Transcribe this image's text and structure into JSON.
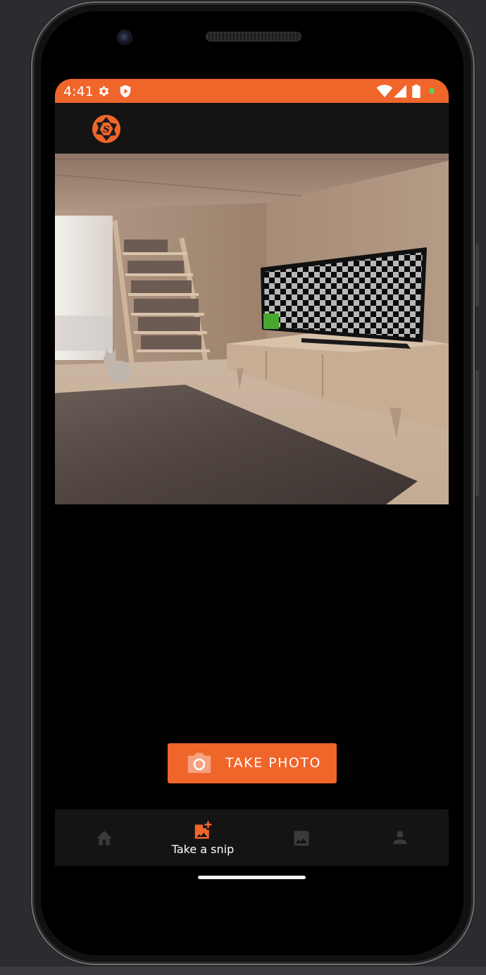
{
  "status_bar": {
    "time": "4:41",
    "background_color": "#f0652a",
    "icons": [
      "settings-gear-icon",
      "shield-icon",
      "wifi-icon",
      "signal-icon",
      "battery-icon",
      "notification-dot-icon"
    ]
  },
  "app_bar": {
    "logo": "aperture-s-logo",
    "logo_letter": "S"
  },
  "preview": {
    "content": "room-interior-photo"
  },
  "actions": {
    "take_photo_label": "TAKE PHOTO",
    "take_photo_icon": "camera-icon"
  },
  "bottom_nav": {
    "items": [
      {
        "icon": "home-icon",
        "label": "",
        "active": false
      },
      {
        "icon": "add-photo-icon",
        "label": "Take a snip",
        "active": true
      },
      {
        "icon": "gallery-icon",
        "label": "",
        "active": false
      },
      {
        "icon": "profile-icon",
        "label": "",
        "active": false
      }
    ],
    "active_color": "#f0652a",
    "inactive_color": "#3a3a3a"
  },
  "colors": {
    "accent": "#f0652a",
    "screen_bg": "#000000",
    "bar_bg": "#141414"
  }
}
